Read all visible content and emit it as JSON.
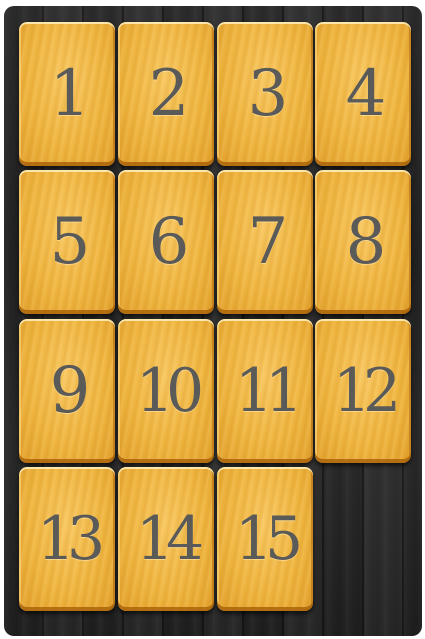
{
  "puzzle": {
    "tiles": [
      {
        "label": "1"
      },
      {
        "label": "2"
      },
      {
        "label": "3"
      },
      {
        "label": "4"
      },
      {
        "label": "5"
      },
      {
        "label": "6"
      },
      {
        "label": "7"
      },
      {
        "label": "8"
      },
      {
        "label": "9"
      },
      {
        "label": "10"
      },
      {
        "label": "11"
      },
      {
        "label": "12"
      },
      {
        "label": "13"
      },
      {
        "label": "14"
      },
      {
        "label": "15"
      }
    ],
    "empty_slot": {
      "row": 4,
      "col": 4
    },
    "colors": {
      "tile": "#f0b640",
      "digit": "#5a5a58",
      "board": "#252525"
    }
  }
}
